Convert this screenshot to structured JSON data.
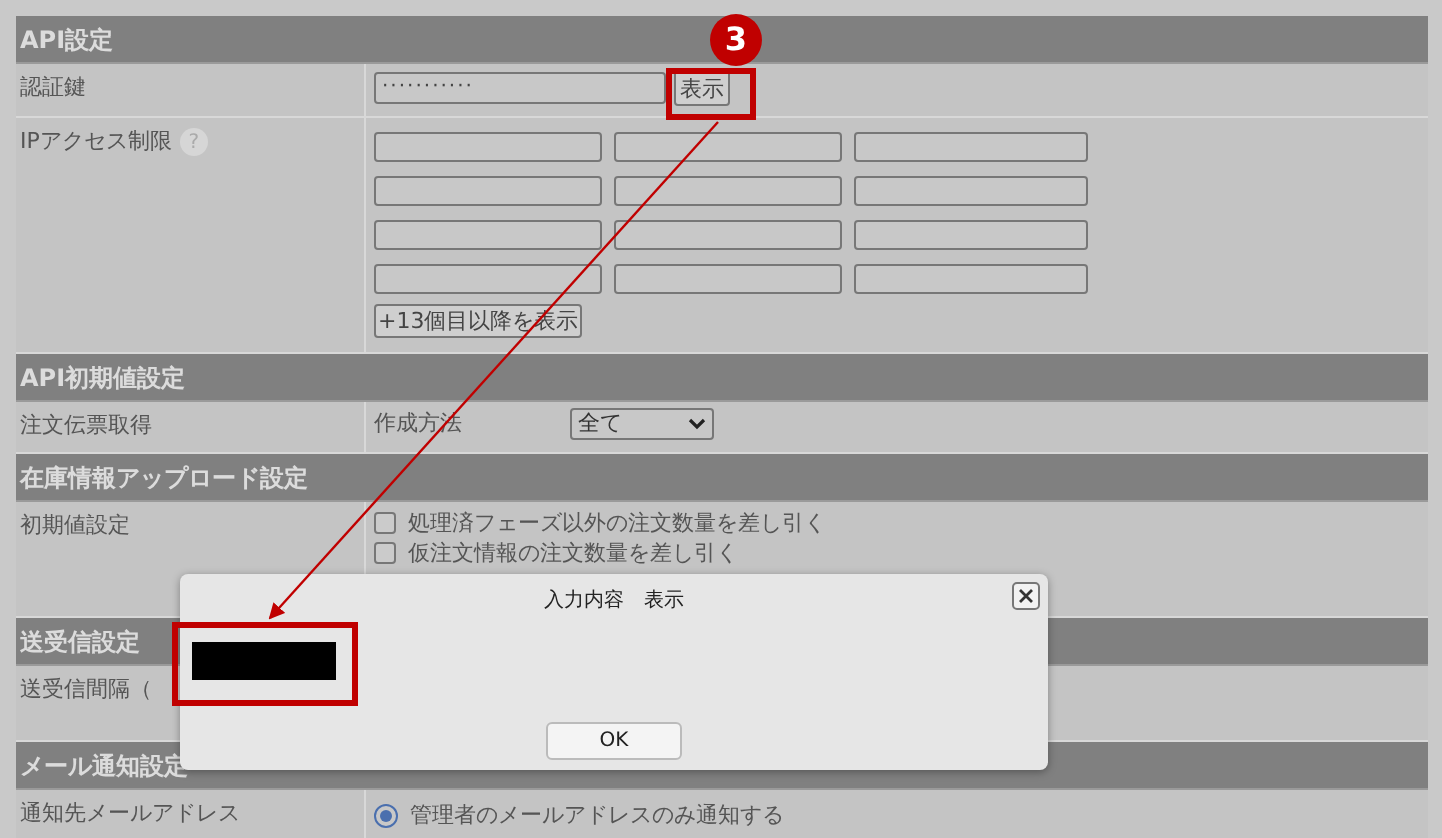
{
  "sections": [
    {
      "title": "API設定",
      "rows": [
        {
          "kind": "password",
          "label": "認証鍵",
          "value": "···········",
          "button": "表示"
        },
        {
          "kind": "ip_grid",
          "label": "IPアクセス制限",
          "help": "?",
          "button": "+13個目以降を表示"
        }
      ]
    },
    {
      "title": "API初期値設定",
      "rows": [
        {
          "kind": "select",
          "label": "注文伝票取得",
          "sublabel": "作成方法",
          "value": "全て"
        }
      ]
    },
    {
      "title": "在庫情報アップロード設定",
      "rows": [
        {
          "kind": "checkboxes",
          "label": "初期値設定",
          "options": [
            {
              "label": "処理済フェーズ以外の注文数量を差し引く",
              "checked": false
            },
            {
              "label": "仮注文情報の注文数量を差し引く",
              "checked": false
            }
          ]
        }
      ]
    },
    {
      "title": "送受信設定",
      "rows": [
        {
          "kind": "text",
          "label": "送受信間隔（"
        }
      ]
    },
    {
      "title": "メール通知設定",
      "rows": [
        {
          "kind": "radio",
          "label": "通知先メールアドレス",
          "options": [
            {
              "label": "管理者のメールアドレスのみ通知する",
              "selected": true
            }
          ]
        }
      ]
    }
  ],
  "dialog": {
    "title": "入力内容　表示",
    "button": "OK"
  },
  "annotation": {
    "badge": "3"
  }
}
